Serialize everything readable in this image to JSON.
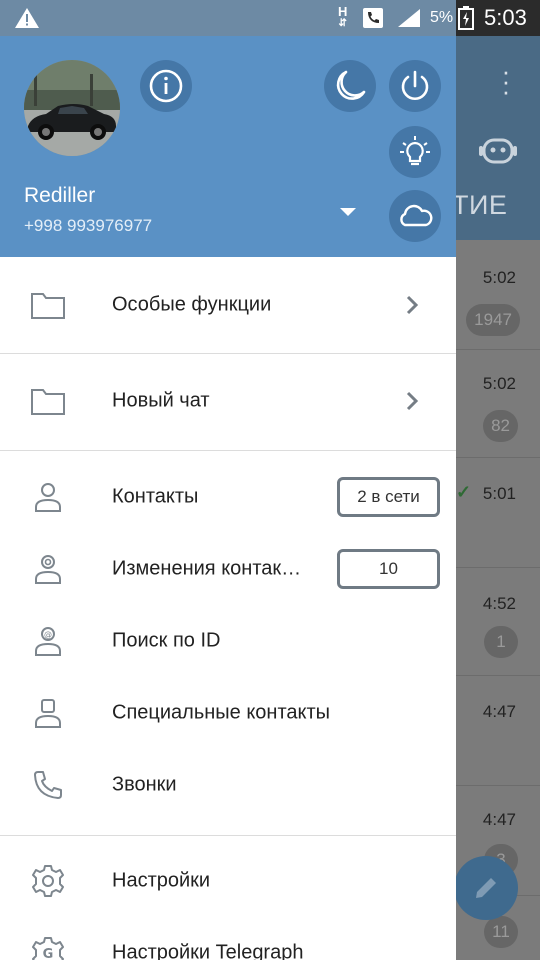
{
  "status_bar": {
    "network": "H",
    "battery_percent": "5%",
    "time": "5:03"
  },
  "drawer": {
    "user": {
      "name": "Rediller",
      "phone": "+998 993976977"
    },
    "sections": [
      {
        "label": "Особые функции"
      },
      {
        "label": "Новый чат"
      }
    ],
    "items": {
      "contacts": {
        "label": "Контакты",
        "badge": "2 в сети"
      },
      "contact_changes": {
        "label": "Изменения контак…",
        "badge": "10"
      },
      "search_by_id": {
        "label": "Поиск по ID"
      },
      "special_contacts": {
        "label": "Специальные контакты"
      },
      "calls": {
        "label": "Звонки"
      },
      "settings": {
        "label": "Настройки"
      },
      "telegraph_settings": {
        "label": "Настройки Telegraph"
      }
    }
  },
  "background_chat": {
    "tab_fragment": "ТИЕ",
    "rows": [
      {
        "time": "5:02",
        "badge": "1947"
      },
      {
        "time": "5:02",
        "badge": "82"
      },
      {
        "time": "5:01",
        "badge": ""
      },
      {
        "time": "4:52",
        "badge": "1"
      },
      {
        "time": "4:47",
        "badge": ""
      },
      {
        "time": "4:47",
        "badge": "3"
      },
      {
        "time": "",
        "badge": "11"
      }
    ]
  },
  "colors": {
    "header_blue": "#5a91c5",
    "button_blue": "#4577a7",
    "dim_overlay": "#7b7b7b"
  }
}
